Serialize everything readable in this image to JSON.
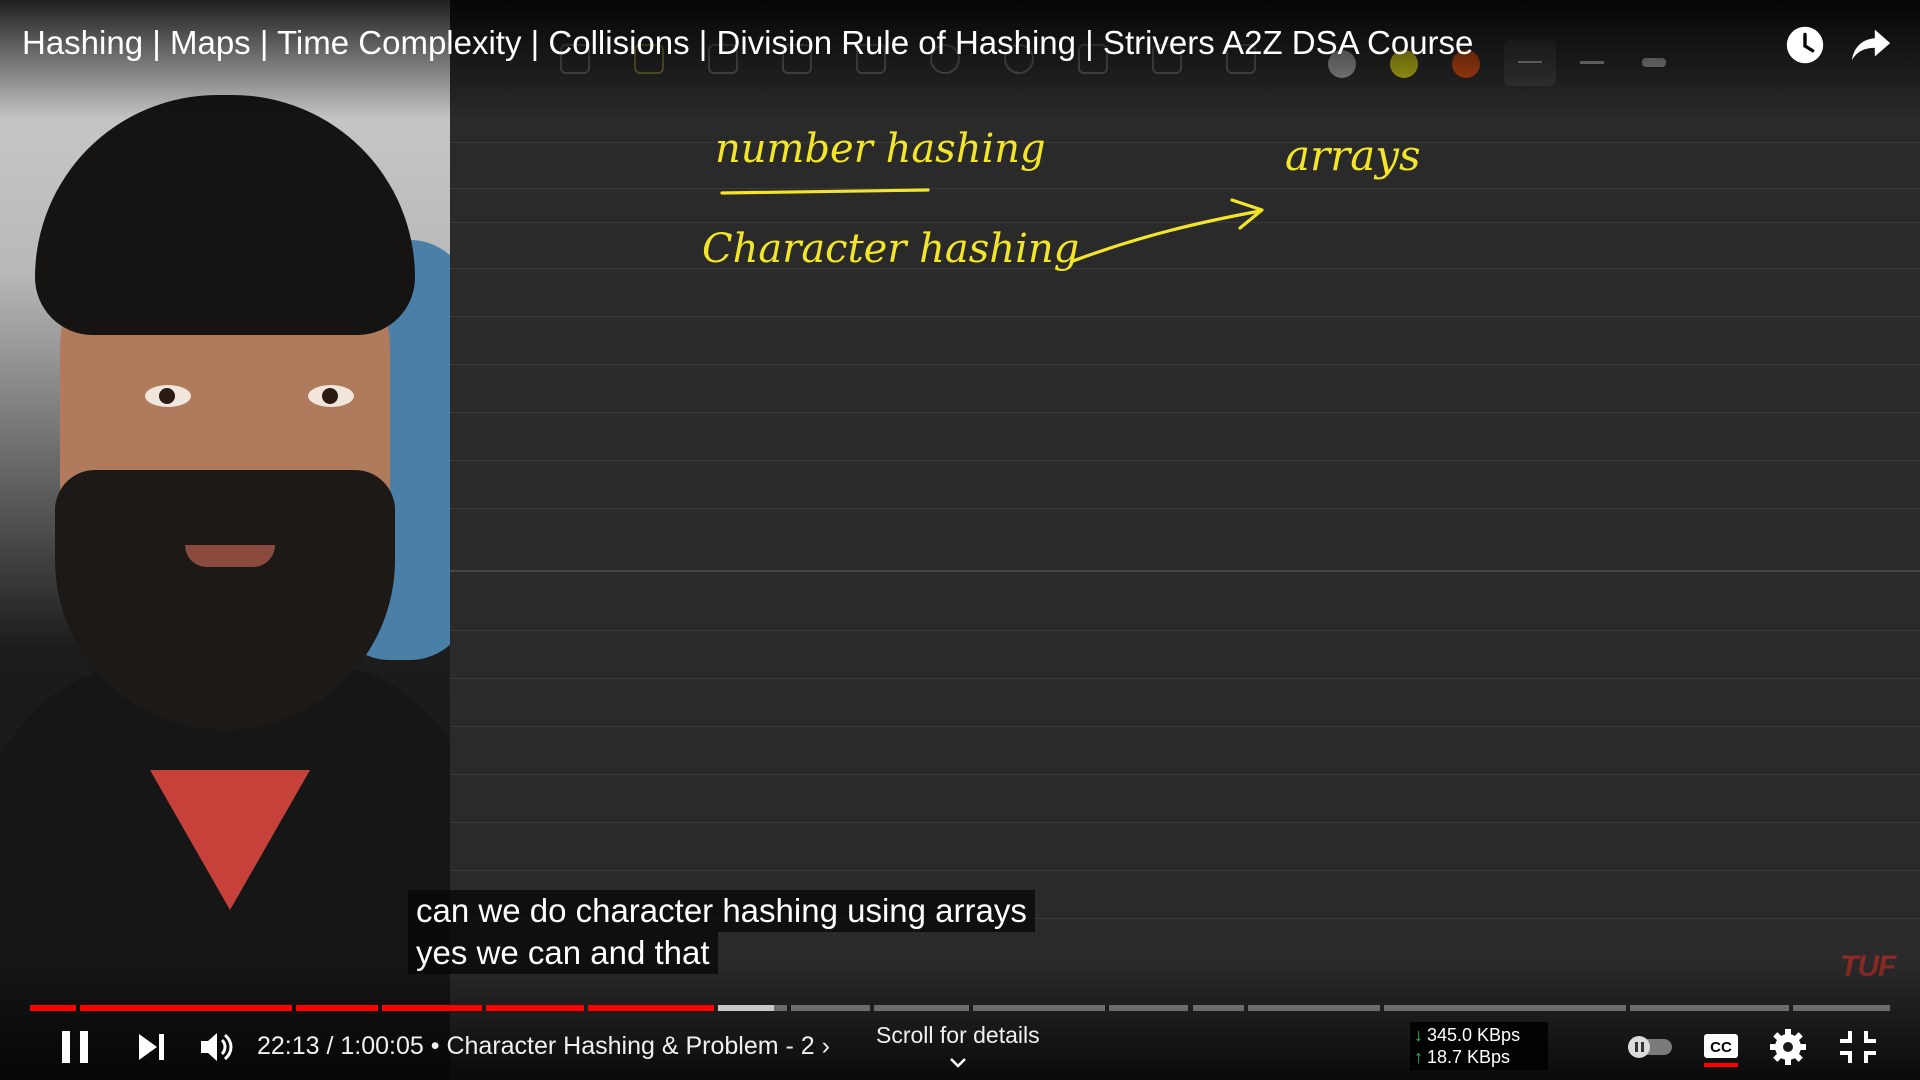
{
  "video": {
    "title": "Hashing | Maps | Time Complexity | Collisions | Division Rule of Hashing | Strivers A2Z DSA Course",
    "watermark": "TUF",
    "board_ink_color": "#f2e52a",
    "board_notes": [
      "number hashing",
      "Character hashing",
      "arrays"
    ]
  },
  "captions": {
    "line1": "can we do character hashing using arrays",
    "line2": "yes we can and that"
  },
  "player": {
    "time_current": "22:13",
    "time_total": "1:00:05",
    "time_display": "22:13 / 1:00:05 • Character Hashing & Problem - 2 ›",
    "chapter": "Character Hashing & Problem - 2",
    "progress_fraction": 0.37,
    "buffered_fraction": 0.4,
    "scroll_hint": "Scroll for details",
    "download_speed": "345.0 KBps",
    "upload_speed": "18.7 KBps",
    "accent_color": "#ff0000",
    "icons": [
      "clock-icon",
      "share-icon",
      "pause-icon",
      "next-icon",
      "volume-icon",
      "autoplay-toggle-icon",
      "cc-icon",
      "settings-icon",
      "exit-fullscreen-icon",
      "chevron-down-icon"
    ]
  }
}
